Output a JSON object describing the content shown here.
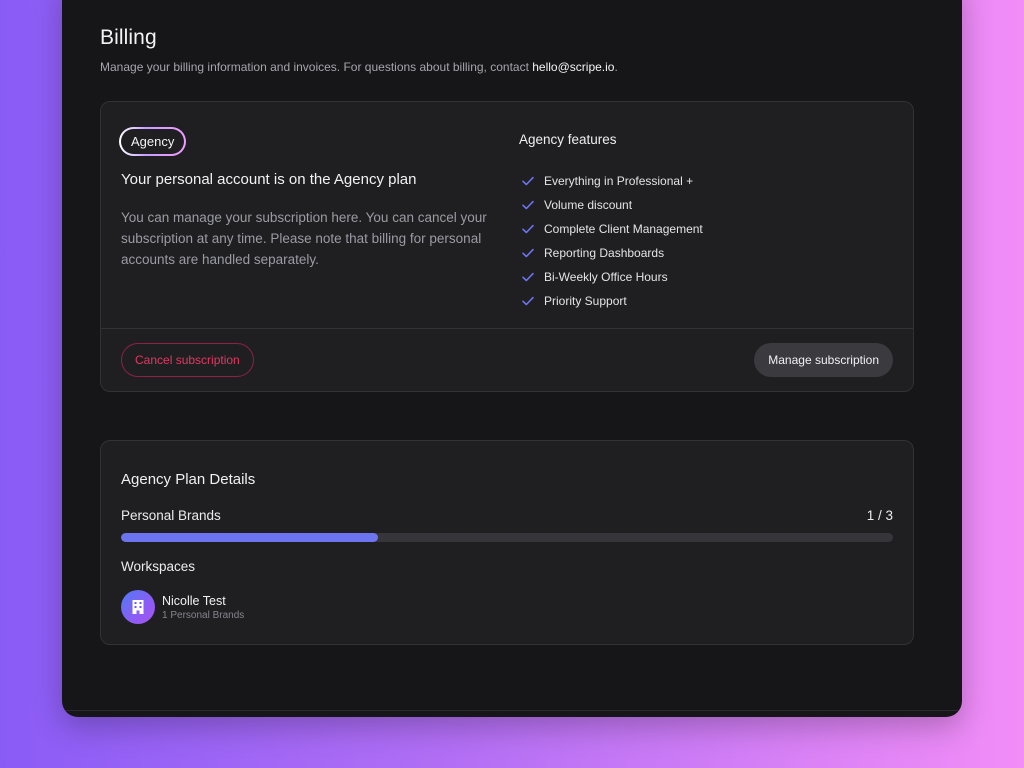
{
  "billing": {
    "title": "Billing",
    "subtitle_prefix": "Manage your billing information and invoices. For questions about billing, contact ",
    "email": "hello@scripe.io",
    "subtitle_suffix": "."
  },
  "plan": {
    "badge": "Agency",
    "title": "Your personal account is on the Agency plan",
    "description": "You can manage your subscription here. You can cancel your subscription at any time. Please note that billing for personal accounts are handled separately.",
    "features_title": "Agency features",
    "features": [
      "Everything in Professional +",
      "Volume discount",
      "Complete Client Management",
      "Reporting Dashboards",
      "Bi-Weekly Office Hours",
      "Priority Support"
    ],
    "cancel_label": "Cancel subscription",
    "manage_label": "Manage subscription"
  },
  "details": {
    "title": "Agency Plan Details",
    "usage_label": "Personal Brands",
    "usage_value": "1 / 3",
    "usage_fraction": 0.333,
    "workspaces_title": "Workspaces",
    "workspaces": [
      {
        "name": "Nicolle Test",
        "subtitle": "1 Personal Brands"
      }
    ]
  },
  "colors": {
    "accent": "#6d74f0",
    "danger": "#e33862",
    "check": "#6d74f0"
  }
}
